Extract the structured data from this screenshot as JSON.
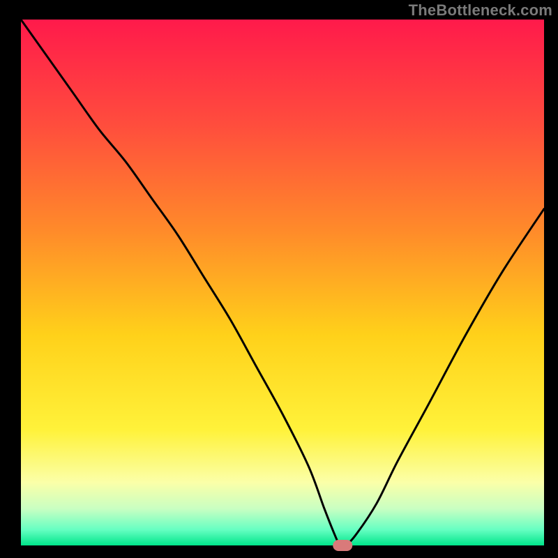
{
  "watermark": "TheBottleneck.com",
  "chart_data": {
    "type": "line",
    "title": "",
    "xlabel": "",
    "ylabel": "",
    "xlim": [
      0,
      100
    ],
    "ylim": [
      0,
      100
    ],
    "grid": false,
    "legend": false,
    "background_gradient": {
      "stops": [
        {
          "offset": 0.0,
          "color": "#ff1a4b"
        },
        {
          "offset": 0.2,
          "color": "#ff4d3d"
        },
        {
          "offset": 0.4,
          "color": "#ff8a2a"
        },
        {
          "offset": 0.6,
          "color": "#ffd11a"
        },
        {
          "offset": 0.78,
          "color": "#fff23a"
        },
        {
          "offset": 0.88,
          "color": "#fbffa8"
        },
        {
          "offset": 0.93,
          "color": "#c9ffc2"
        },
        {
          "offset": 0.97,
          "color": "#66ffc2"
        },
        {
          "offset": 1.0,
          "color": "#00e58a"
        }
      ]
    },
    "series": [
      {
        "name": "bottleneck-curve",
        "x": [
          0,
          5,
          10,
          15,
          20,
          25,
          30,
          35,
          40,
          45,
          50,
          55,
          58,
          60,
          61,
          62,
          64,
          68,
          72,
          78,
          85,
          92,
          100
        ],
        "y": [
          100,
          93,
          86,
          79,
          73,
          66,
          59,
          51,
          43,
          34,
          25,
          15,
          7,
          2,
          0,
          0,
          2,
          8,
          16,
          27,
          40,
          52,
          64
        ]
      }
    ],
    "marker": {
      "name": "optimal-point",
      "x": 61.5,
      "y": 0,
      "color": "#d97a7a",
      "rx": 14,
      "ry": 8
    },
    "frame": {
      "left_width": 30,
      "right_width": 20,
      "top_height": 28,
      "bottom_height": 18,
      "color": "#000000"
    }
  }
}
